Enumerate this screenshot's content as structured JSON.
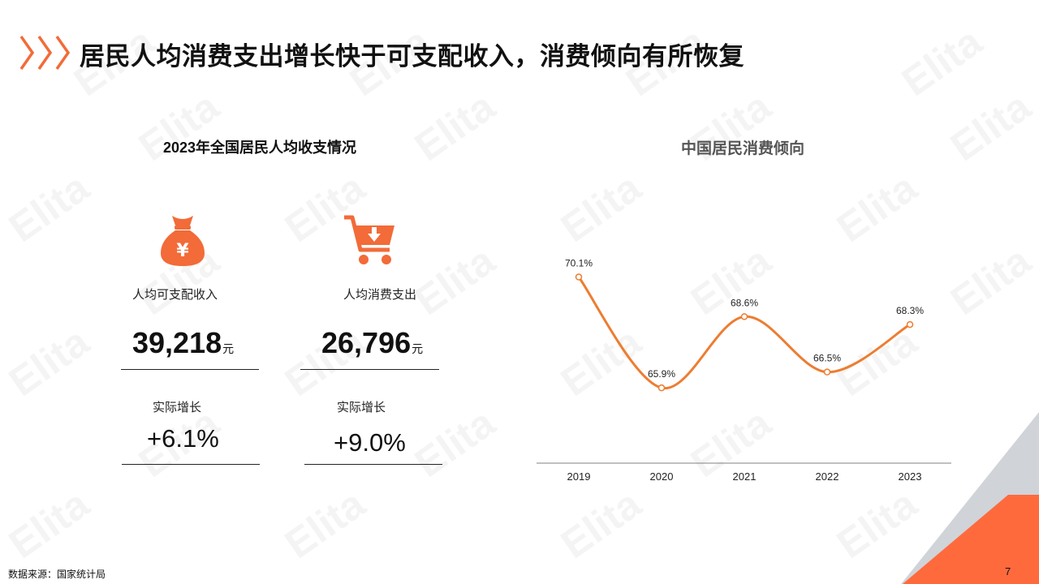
{
  "title": "居民人均消费支出增长快于可支配收入，消费倾向有所恢复",
  "left_panel": {
    "title": "2023年全国居民人均收支情况",
    "income": {
      "label": "人均可支配收入",
      "value": "39,218",
      "unit": "元",
      "growth_label": "实际增长",
      "growth_value": "+6.1%",
      "icon": "money-bag-icon"
    },
    "spending": {
      "label": "人均消费支出",
      "value": "26,796",
      "unit": "元",
      "growth_label": "实际增长",
      "growth_value": "+9.0%",
      "icon": "shopping-cart-icon"
    }
  },
  "chart_title": "中国居民消费倾向",
  "chart_data": {
    "type": "line",
    "title": "中国居民消费倾向",
    "categories": [
      "2019",
      "2020",
      "2021",
      "2022",
      "2023"
    ],
    "series": [
      {
        "values": [
          70.1,
          65.9,
          68.6,
          66.5,
          68.3
        ],
        "labels": [
          "70.1%",
          "65.9%",
          "68.6%",
          "66.5%",
          "68.3%"
        ]
      }
    ],
    "ylim": [
      64,
      71.5
    ],
    "grid": false,
    "color": "#ED7D31"
  },
  "footer": {
    "source": "数据来源：国家统计局",
    "page_number": "7"
  },
  "watermark": "Elita",
  "colors": {
    "accent": "#F26B38",
    "line": "#ED7D31",
    "corner_gray": "#D0D3D8"
  }
}
